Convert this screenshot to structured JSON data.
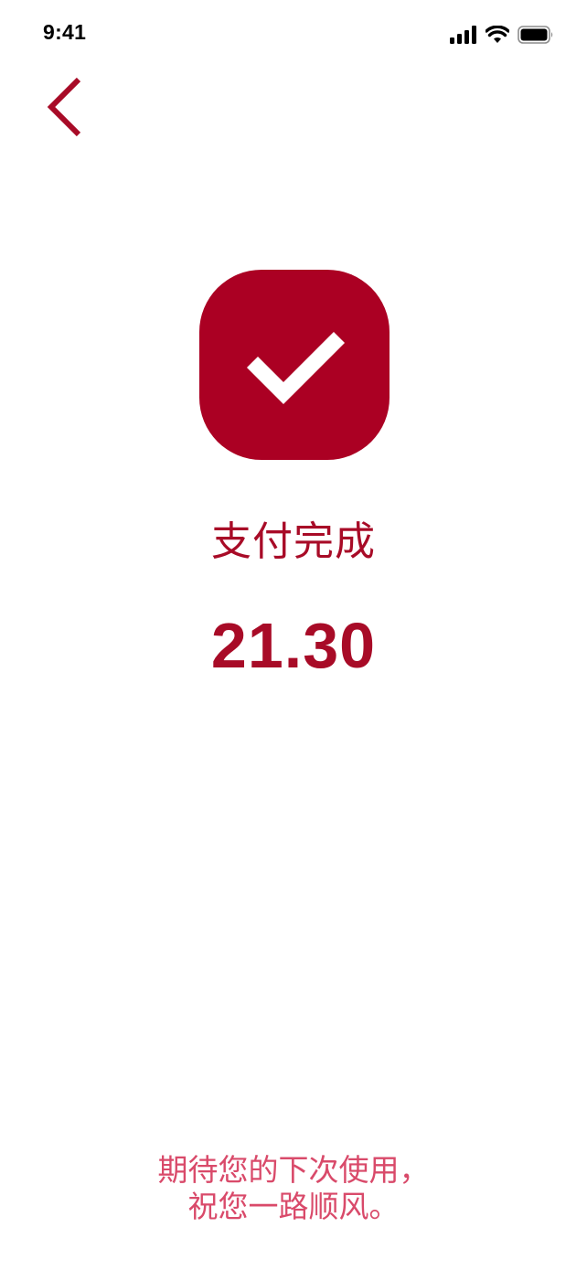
{
  "status_bar": {
    "time": "9:41",
    "icons": [
      "cellular-signal-icon",
      "wifi-icon",
      "battery-icon"
    ]
  },
  "nav": {
    "back_icon": "chevron-left-icon"
  },
  "result": {
    "icon": "checkmark-icon",
    "title": "支付完成",
    "amount": "21.30"
  },
  "footer": {
    "line1": "期待您的下次使用，",
    "line2": "祝您一路顺风。"
  },
  "colors": {
    "accent": "#ab0023",
    "title_text": "#a80b27",
    "footer_text": "#d94a6a",
    "background": "#ffffff"
  }
}
